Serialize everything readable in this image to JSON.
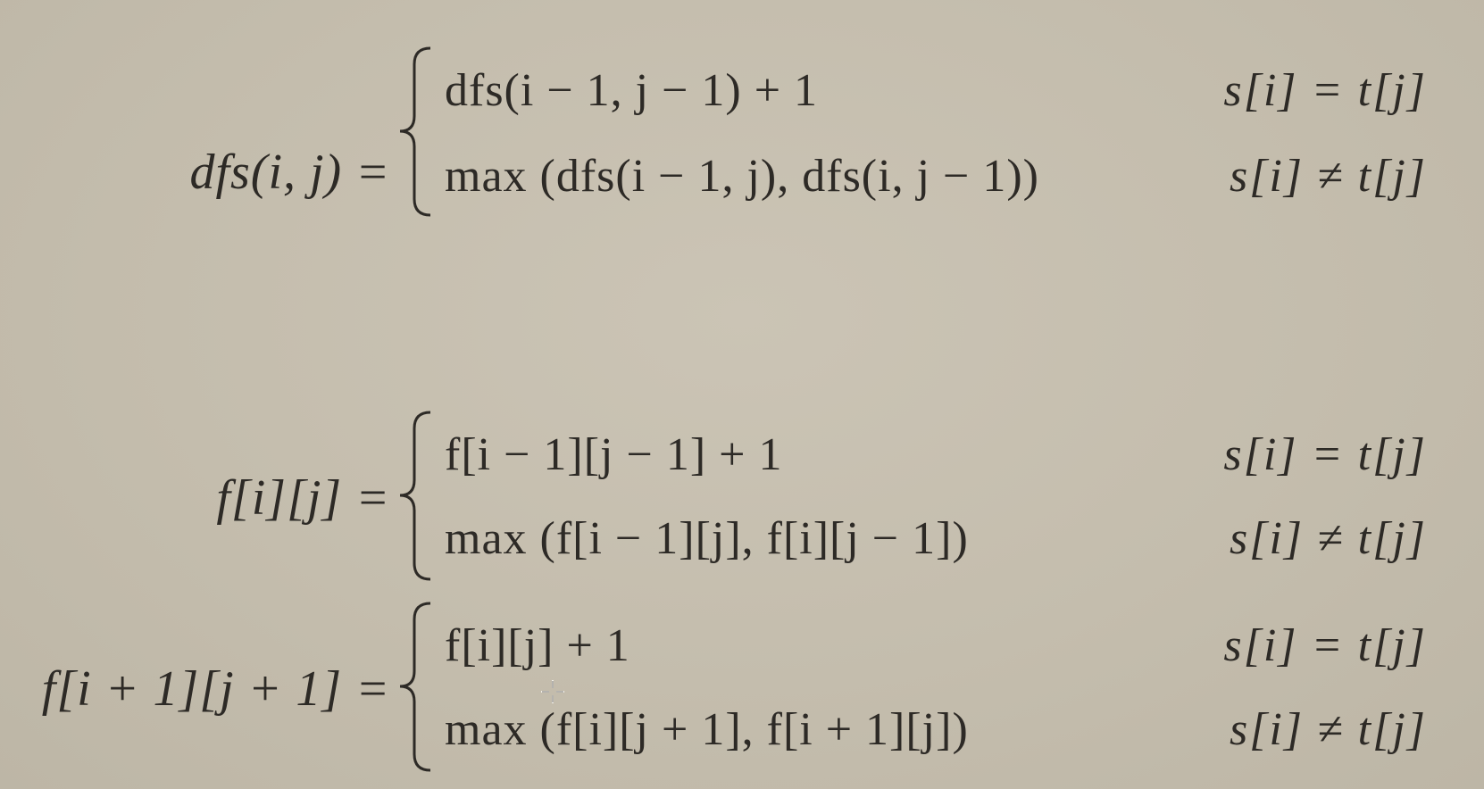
{
  "equations": [
    {
      "lhs": "dfs(i, j) =",
      "cases": [
        {
          "expr": "dfs(i − 1, j − 1) + 1",
          "cond": "s[i] = t[j]"
        },
        {
          "expr": "max (dfs(i − 1, j), dfs(i, j − 1))",
          "cond": "s[i] ≠ t[j]"
        }
      ]
    },
    {
      "lhs": "f[i][j] =",
      "cases": [
        {
          "expr": "f[i − 1][j − 1] + 1",
          "cond": "s[i] = t[j]"
        },
        {
          "expr": "max (f[i − 1][j], f[i][j − 1])",
          "cond": "s[i] ≠ t[j]"
        }
      ]
    },
    {
      "lhs": "f[i + 1][j + 1] =",
      "cases": [
        {
          "expr": "f[i][j] + 1",
          "cond": "s[i] = t[j]"
        },
        {
          "expr": "max (f[i][j + 1], f[i + 1][j])",
          "cond": "s[i] ≠ t[j]"
        }
      ]
    }
  ],
  "icons": {
    "cursor": "crosshair-cursor-icon"
  }
}
